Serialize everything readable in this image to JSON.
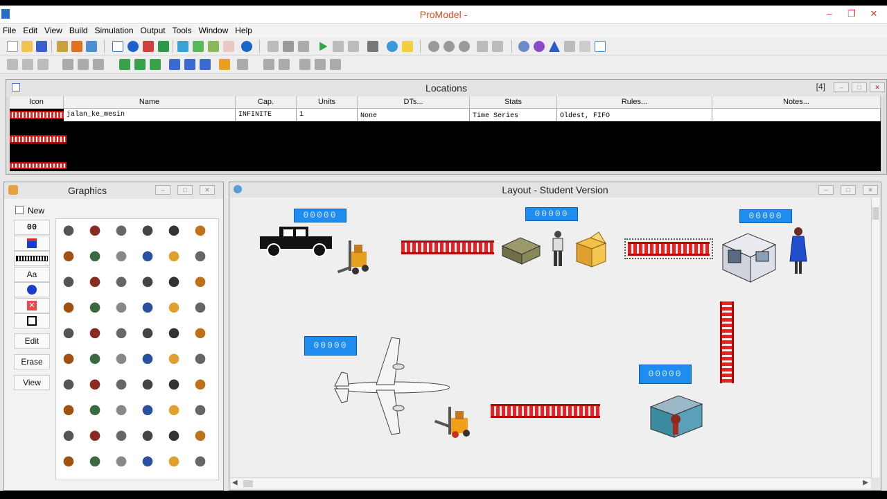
{
  "window": {
    "title": "ProModel -"
  },
  "menu": [
    "File",
    "Edit",
    "View",
    "Build",
    "Simulation",
    "Output",
    "Tools",
    "Window",
    "Help"
  ],
  "locations": {
    "title": "Locations",
    "count": "[4]",
    "columns": [
      "Icon",
      "Name",
      "Cap.",
      "Units",
      "DTs...",
      "Stats",
      "Rules...",
      "Notes..."
    ],
    "row": {
      "name": "jalan_ke_mesin",
      "cap": "INFINITE",
      "units": "1",
      "dts": "None",
      "stats": "Time Series",
      "rules": "Oldest, FIFO",
      "notes": ""
    }
  },
  "graphics": {
    "title": "Graphics",
    "new_label": "New",
    "counter_label": "00",
    "text_label": "Aa",
    "edit": "Edit",
    "erase": "Erase",
    "view": "View"
  },
  "layout": {
    "title": "Layout - Student Version",
    "counter_text": "00000"
  },
  "colors": {
    "accent": "#1f8cf0",
    "conveyor": "#e42424",
    "title": "#e04a24"
  }
}
